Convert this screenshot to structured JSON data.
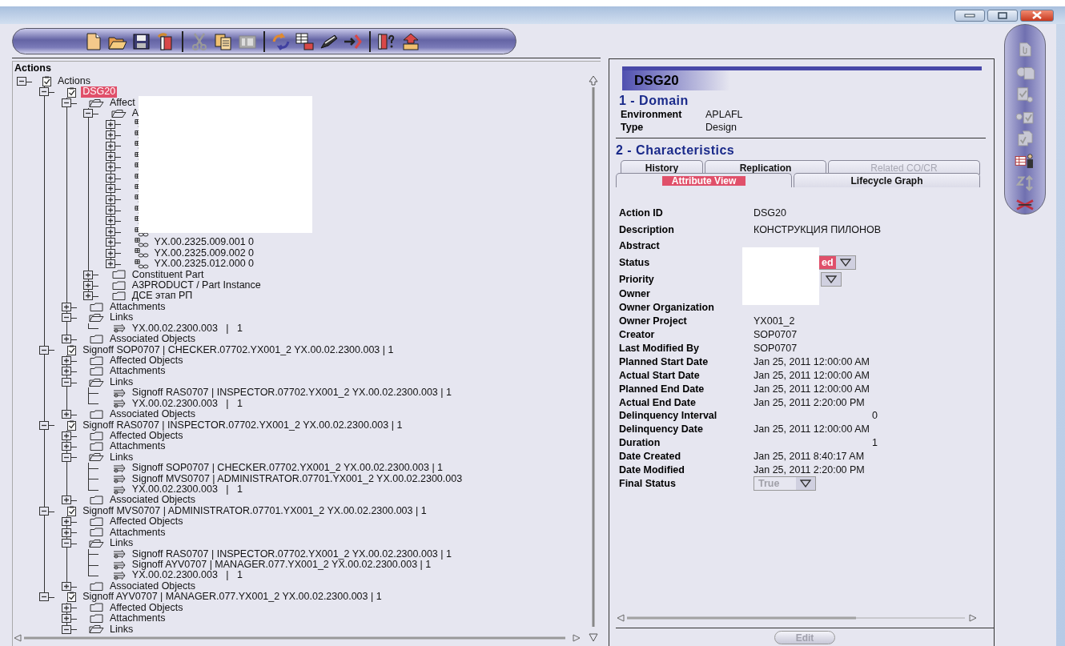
{
  "tree_panel": {
    "title": "Actions",
    "tree": [
      {
        "label": "Actions",
        "kind": "action",
        "expanded": true,
        "selected": false,
        "children": [
          {
            "label": "DSG20",
            "kind": "action",
            "expanded": true,
            "selected": true,
            "children": [
              {
                "label": "Affect",
                "kind": "folder",
                "expanded": true,
                "selected": false,
                "children": [
                  {
                    "label": "A",
                    "kind": "folder",
                    "expanded": true,
                    "selected": false,
                    "children": [
                      {
                        "kind": "part",
                        "expanded": false
                      },
                      {
                        "kind": "part",
                        "expanded": false
                      },
                      {
                        "kind": "part",
                        "expanded": false
                      },
                      {
                        "kind": "part",
                        "expanded": false
                      },
                      {
                        "kind": "part",
                        "expanded": false
                      },
                      {
                        "kind": "part",
                        "expanded": false
                      },
                      {
                        "kind": "part",
                        "expanded": false
                      },
                      {
                        "kind": "part",
                        "expanded": false
                      },
                      {
                        "kind": "part",
                        "expanded": false
                      },
                      {
                        "kind": "part",
                        "expanded": false
                      },
                      {
                        "kind": "part",
                        "expanded": false
                      },
                      {
                        "label": "YX.00.2325.009.001 0",
                        "kind": "part",
                        "expanded": false,
                        "selected": false
                      },
                      {
                        "label": "YX.00.2325.009.002 0",
                        "kind": "part",
                        "expanded": false,
                        "selected": false
                      },
                      {
                        "label": "YX.00.2325.012.000 0",
                        "kind": "part",
                        "expanded": false,
                        "selected": false
                      }
                    ]
                  },
                  {
                    "label": "Constituent Part",
                    "kind": "folder",
                    "expanded": false,
                    "selected": false
                  },
                  {
                    "label": "A3PRODUCT / Part Instance",
                    "kind": "folder",
                    "expanded": false,
                    "selected": false
                  },
                  {
                    "label": "ДСЕ этап РП",
                    "kind": "folder",
                    "expanded": false,
                    "selected": false
                  }
                ]
              },
              {
                "label": "Attachments",
                "kind": "folder",
                "expanded": false,
                "selected": false
              },
              {
                "label": "Links",
                "kind": "folder",
                "expanded": true,
                "selected": false,
                "children": [
                  {
                    "label": "YX.00.02.2300.003   |   1",
                    "kind": "link",
                    "selected": false
                  }
                ]
              },
              {
                "label": "Associated Objects",
                "kind": "folder",
                "expanded": false,
                "selected": false
              }
            ]
          },
          {
            "label": "Signoff SOP0707 | CHECKER.07702.YX001_2 YX.00.02.2300.003 | 1",
            "kind": "action",
            "expanded": true,
            "selected": false,
            "children": [
              {
                "label": "Affected Objects",
                "kind": "folder",
                "expanded": false,
                "selected": false
              },
              {
                "label": "Attachments",
                "kind": "folder",
                "expanded": false,
                "selected": false
              },
              {
                "label": "Links",
                "kind": "folder",
                "expanded": true,
                "selected": false,
                "children": [
                  {
                    "label": "Signoff RAS0707 | INSPECTOR.07702.YX001_2 YX.00.02.2300.003 | 1",
                    "kind": "link",
                    "selected": false
                  },
                  {
                    "label": "YX.00.02.2300.003   |   1",
                    "kind": "link",
                    "selected": false
                  }
                ]
              },
              {
                "label": "Associated Objects",
                "kind": "folder",
                "expanded": false,
                "selected": false
              }
            ]
          },
          {
            "label": "Signoff RAS0707 | INSPECTOR.07702.YX001_2 YX.00.02.2300.003 | 1",
            "kind": "action",
            "expanded": true,
            "selected": false,
            "children": [
              {
                "label": "Affected Objects",
                "kind": "folder",
                "expanded": false,
                "selected": false
              },
              {
                "label": "Attachments",
                "kind": "folder",
                "expanded": false,
                "selected": false
              },
              {
                "label": "Links",
                "kind": "folder",
                "expanded": true,
                "selected": false,
                "children": [
                  {
                    "label": "Signoff SOP0707 | CHECKER.07702.YX001_2 YX.00.02.2300.003 | 1",
                    "kind": "link",
                    "selected": false
                  },
                  {
                    "label": "Signoff MVS0707 | ADMINISTRATOR.07701.YX001_2 YX.00.02.2300.003",
                    "kind": "link",
                    "selected": false
                  },
                  {
                    "label": "YX.00.02.2300.003   |   1",
                    "kind": "link",
                    "selected": false
                  }
                ]
              },
              {
                "label": "Associated Objects",
                "kind": "folder",
                "expanded": false,
                "selected": false
              }
            ]
          },
          {
            "label": "Signoff MVS0707 | ADMINISTRATOR.07701.YX001_2 YX.00.02.2300.003 | 1",
            "kind": "action",
            "expanded": true,
            "selected": false,
            "children": [
              {
                "label": "Affected Objects",
                "kind": "folder",
                "expanded": false,
                "selected": false
              },
              {
                "label": "Attachments",
                "kind": "folder",
                "expanded": false,
                "selected": false
              },
              {
                "label": "Links",
                "kind": "folder",
                "expanded": true,
                "selected": false,
                "children": [
                  {
                    "label": "Signoff RAS0707 | INSPECTOR.07702.YX001_2 YX.00.02.2300.003 | 1",
                    "kind": "link",
                    "selected": false
                  },
                  {
                    "label": "Signoff AYV0707 | MANAGER.077.YX001_2 YX.00.02.2300.003 | 1",
                    "kind": "link",
                    "selected": false
                  },
                  {
                    "label": "YX.00.02.2300.003   |   1",
                    "kind": "link",
                    "selected": false
                  }
                ]
              },
              {
                "label": "Associated Objects",
                "kind": "folder",
                "expanded": false,
                "selected": false
              }
            ]
          },
          {
            "label": "Signoff AYV0707 | MANAGER.077.YX001_2 YX.00.02.2300.003 | 1",
            "kind": "action",
            "expanded": true,
            "selected": false,
            "children": [
              {
                "label": "Affected Objects",
                "kind": "folder",
                "expanded": false,
                "selected": false
              },
              {
                "label": "Attachments",
                "kind": "folder",
                "expanded": false,
                "selected": false
              },
              {
                "label": "Links",
                "kind": "folder",
                "expanded": true,
                "selected": false
              }
            ]
          }
        ]
      }
    ]
  },
  "detail": {
    "title": "DSG20",
    "domain": {
      "heading": "1 - Domain",
      "fields": [
        {
          "label": "Environment",
          "value": "APLAFL"
        },
        {
          "label": "Type",
          "value": "Design"
        }
      ]
    },
    "characteristics": {
      "heading": "2 - Characteristics",
      "tab_rows": [
        [
          {
            "label": "History",
            "selected": false,
            "disabled": false
          },
          {
            "label": "Replication",
            "selected": false,
            "disabled": false
          },
          {
            "label": "Related CO/CR",
            "selected": false,
            "disabled": true
          }
        ],
        [
          {
            "label": "Attribute View",
            "selected": true,
            "disabled": false
          },
          {
            "label": "Lifecycle Graph",
            "selected": false,
            "disabled": false
          }
        ]
      ],
      "attributes": [
        {
          "label": "Action ID",
          "kind": "text",
          "value": "DSG20"
        },
        {
          "label": "Description",
          "kind": "text",
          "value": "КОНСТРУКЦИЯ ПИЛОНОВ"
        },
        {
          "label": "Abstract",
          "kind": "text"
        },
        {
          "label": "Status",
          "kind": "dropdown",
          "value": "ed",
          "highlighted": true,
          "disabled": false
        },
        {
          "label": "Priority",
          "kind": "dropdown"
        },
        {
          "label": "Owner",
          "kind": "text"
        },
        {
          "label": "Owner Organization",
          "kind": "text"
        },
        {
          "label": "Owner Project",
          "kind": "text",
          "value": "YX001_2"
        },
        {
          "label": "Creator",
          "kind": "text",
          "value": "SOP0707"
        },
        {
          "label": "Last Modified By",
          "kind": "text",
          "value": "SOP0707"
        },
        {
          "label": "Planned Start Date",
          "kind": "text",
          "value": "Jan 25, 2011 12:00:00 AM"
        },
        {
          "label": "Actual Start Date",
          "kind": "text",
          "value": "Jan 25, 2011 12:00:00 AM"
        },
        {
          "label": "Planned End Date",
          "kind": "text",
          "value": "Jan 25, 2011 12:00:00 AM"
        },
        {
          "label": "Actual End Date",
          "kind": "text",
          "value": "Jan 25, 2011 2:20:00 PM"
        },
        {
          "label": "Delinquency Interval",
          "kind": "number",
          "value": "0"
        },
        {
          "label": "Delinquency Date",
          "kind": "text",
          "value": "Jan 25, 2011 12:00:00 AM"
        },
        {
          "label": "Duration",
          "kind": "number",
          "value": "1"
        },
        {
          "label": "Date Created",
          "kind": "text",
          "value": "Jan 25, 2011 8:40:17 AM"
        },
        {
          "label": "Date Modified",
          "kind": "text",
          "value": "Jan 25, 2011 2:20:00 PM"
        },
        {
          "label": "Final Status",
          "kind": "dropdown",
          "value": "True",
          "highlighted": false,
          "disabled": true
        }
      ]
    },
    "edit_button": {
      "label": "Edit",
      "disabled": true
    }
  }
}
